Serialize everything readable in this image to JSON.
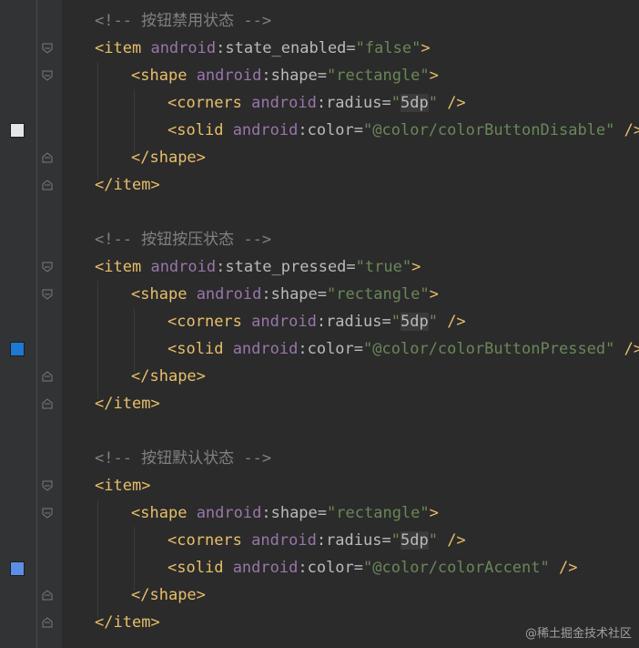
{
  "editor": {
    "comments": {
      "disabled": "<!-- 按钮禁用状态 -->",
      "pressed": "<!-- 按钮按压状态 -->",
      "default": "<!-- 按钮默认状态 -->"
    },
    "syntax": {
      "item_tag": "item",
      "shape_tag": "shape",
      "corners_tag": "corners",
      "solid_tag": "solid",
      "ns": "android",
      "colon": ":",
      "attr_state_enabled": "state_enabled",
      "attr_state_pressed": "state_pressed",
      "attr_shape": "shape",
      "attr_radius": "radius",
      "attr_color": "color",
      "open_bracket": "<",
      "close_bracket": ">",
      "end_open": "</",
      "self_close": " />",
      "equals": "=",
      "quote": "\""
    },
    "values": {
      "false": "false",
      "true": "true",
      "rectangle": "rectangle",
      "radius": "5dp",
      "color_disable": "@color/colorButtonDisable",
      "color_pressed": "@color/colorButtonPressed",
      "color_accent": "@color/colorAccent"
    },
    "swatches": {
      "disable": "#e6e6e6",
      "pressed": "#1f78d1",
      "accent": "#5c8ee6"
    }
  },
  "watermark": "@稀土掘金技术社区"
}
